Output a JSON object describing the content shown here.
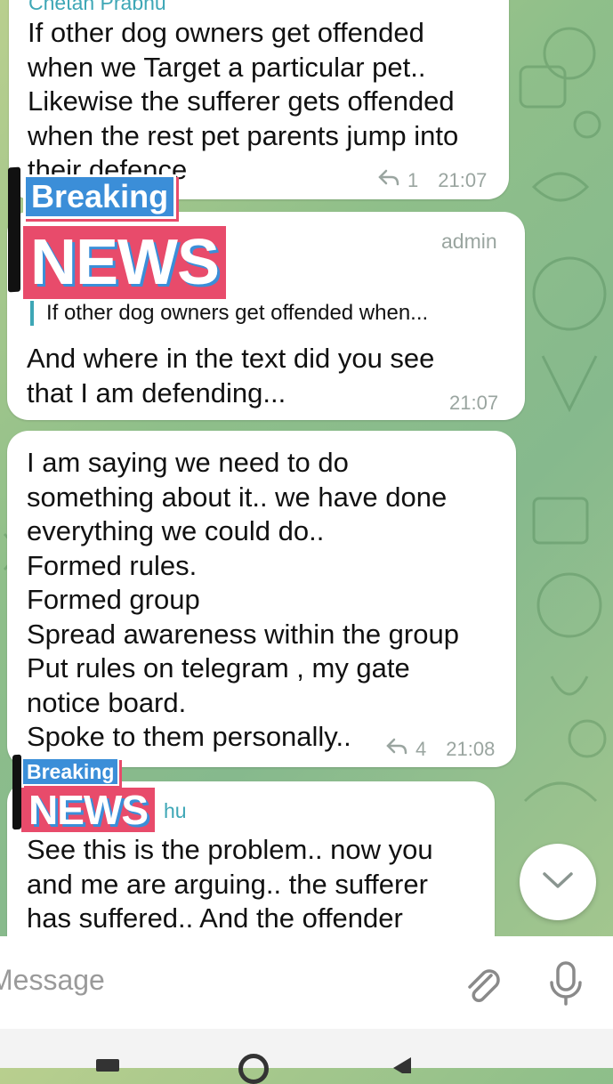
{
  "messages": [
    {
      "sender": "Chetan Prabhu",
      "text": "If other dog owners get offended\nwhen we Target a particular pet..\nLikewise the sufferer gets offended\nwhen the rest pet parents jump into\ntheir defence",
      "reply_count": "1",
      "time": "21:07"
    },
    {
      "badge": "admin",
      "quote": "If other dog owners get offended when...",
      "text": "And where in the text did you see\nthat I am defending...",
      "time": "21:07"
    },
    {
      "text": "I am saying we need to do\nsomething about it.. we have done\neverything we could do..\nFormed rules.\nFormed group\nSpread awareness within the group\nPut rules on telegram , my gate\nnotice board.\nSpoke to them personally..",
      "reply_count": "4",
      "time": "21:08"
    },
    {
      "sender_partial": "hu",
      "text": "See this is the problem.. now you\nand me are arguing.. the sufferer\nhas suffered.. And the offender"
    }
  ],
  "stickers": {
    "line1": "Breaking",
    "line2": "NEWS"
  },
  "composer": {
    "placeholder": "Message",
    "attach_icon": "paperclip-icon",
    "mic_icon": "microphone-icon"
  },
  "scroll_button_icon": "chevron-down-icon",
  "colors": {
    "accent": "#3ea7b6",
    "sticker_pink": "#e84b6b",
    "sticker_blue": "#3b8ed8"
  }
}
